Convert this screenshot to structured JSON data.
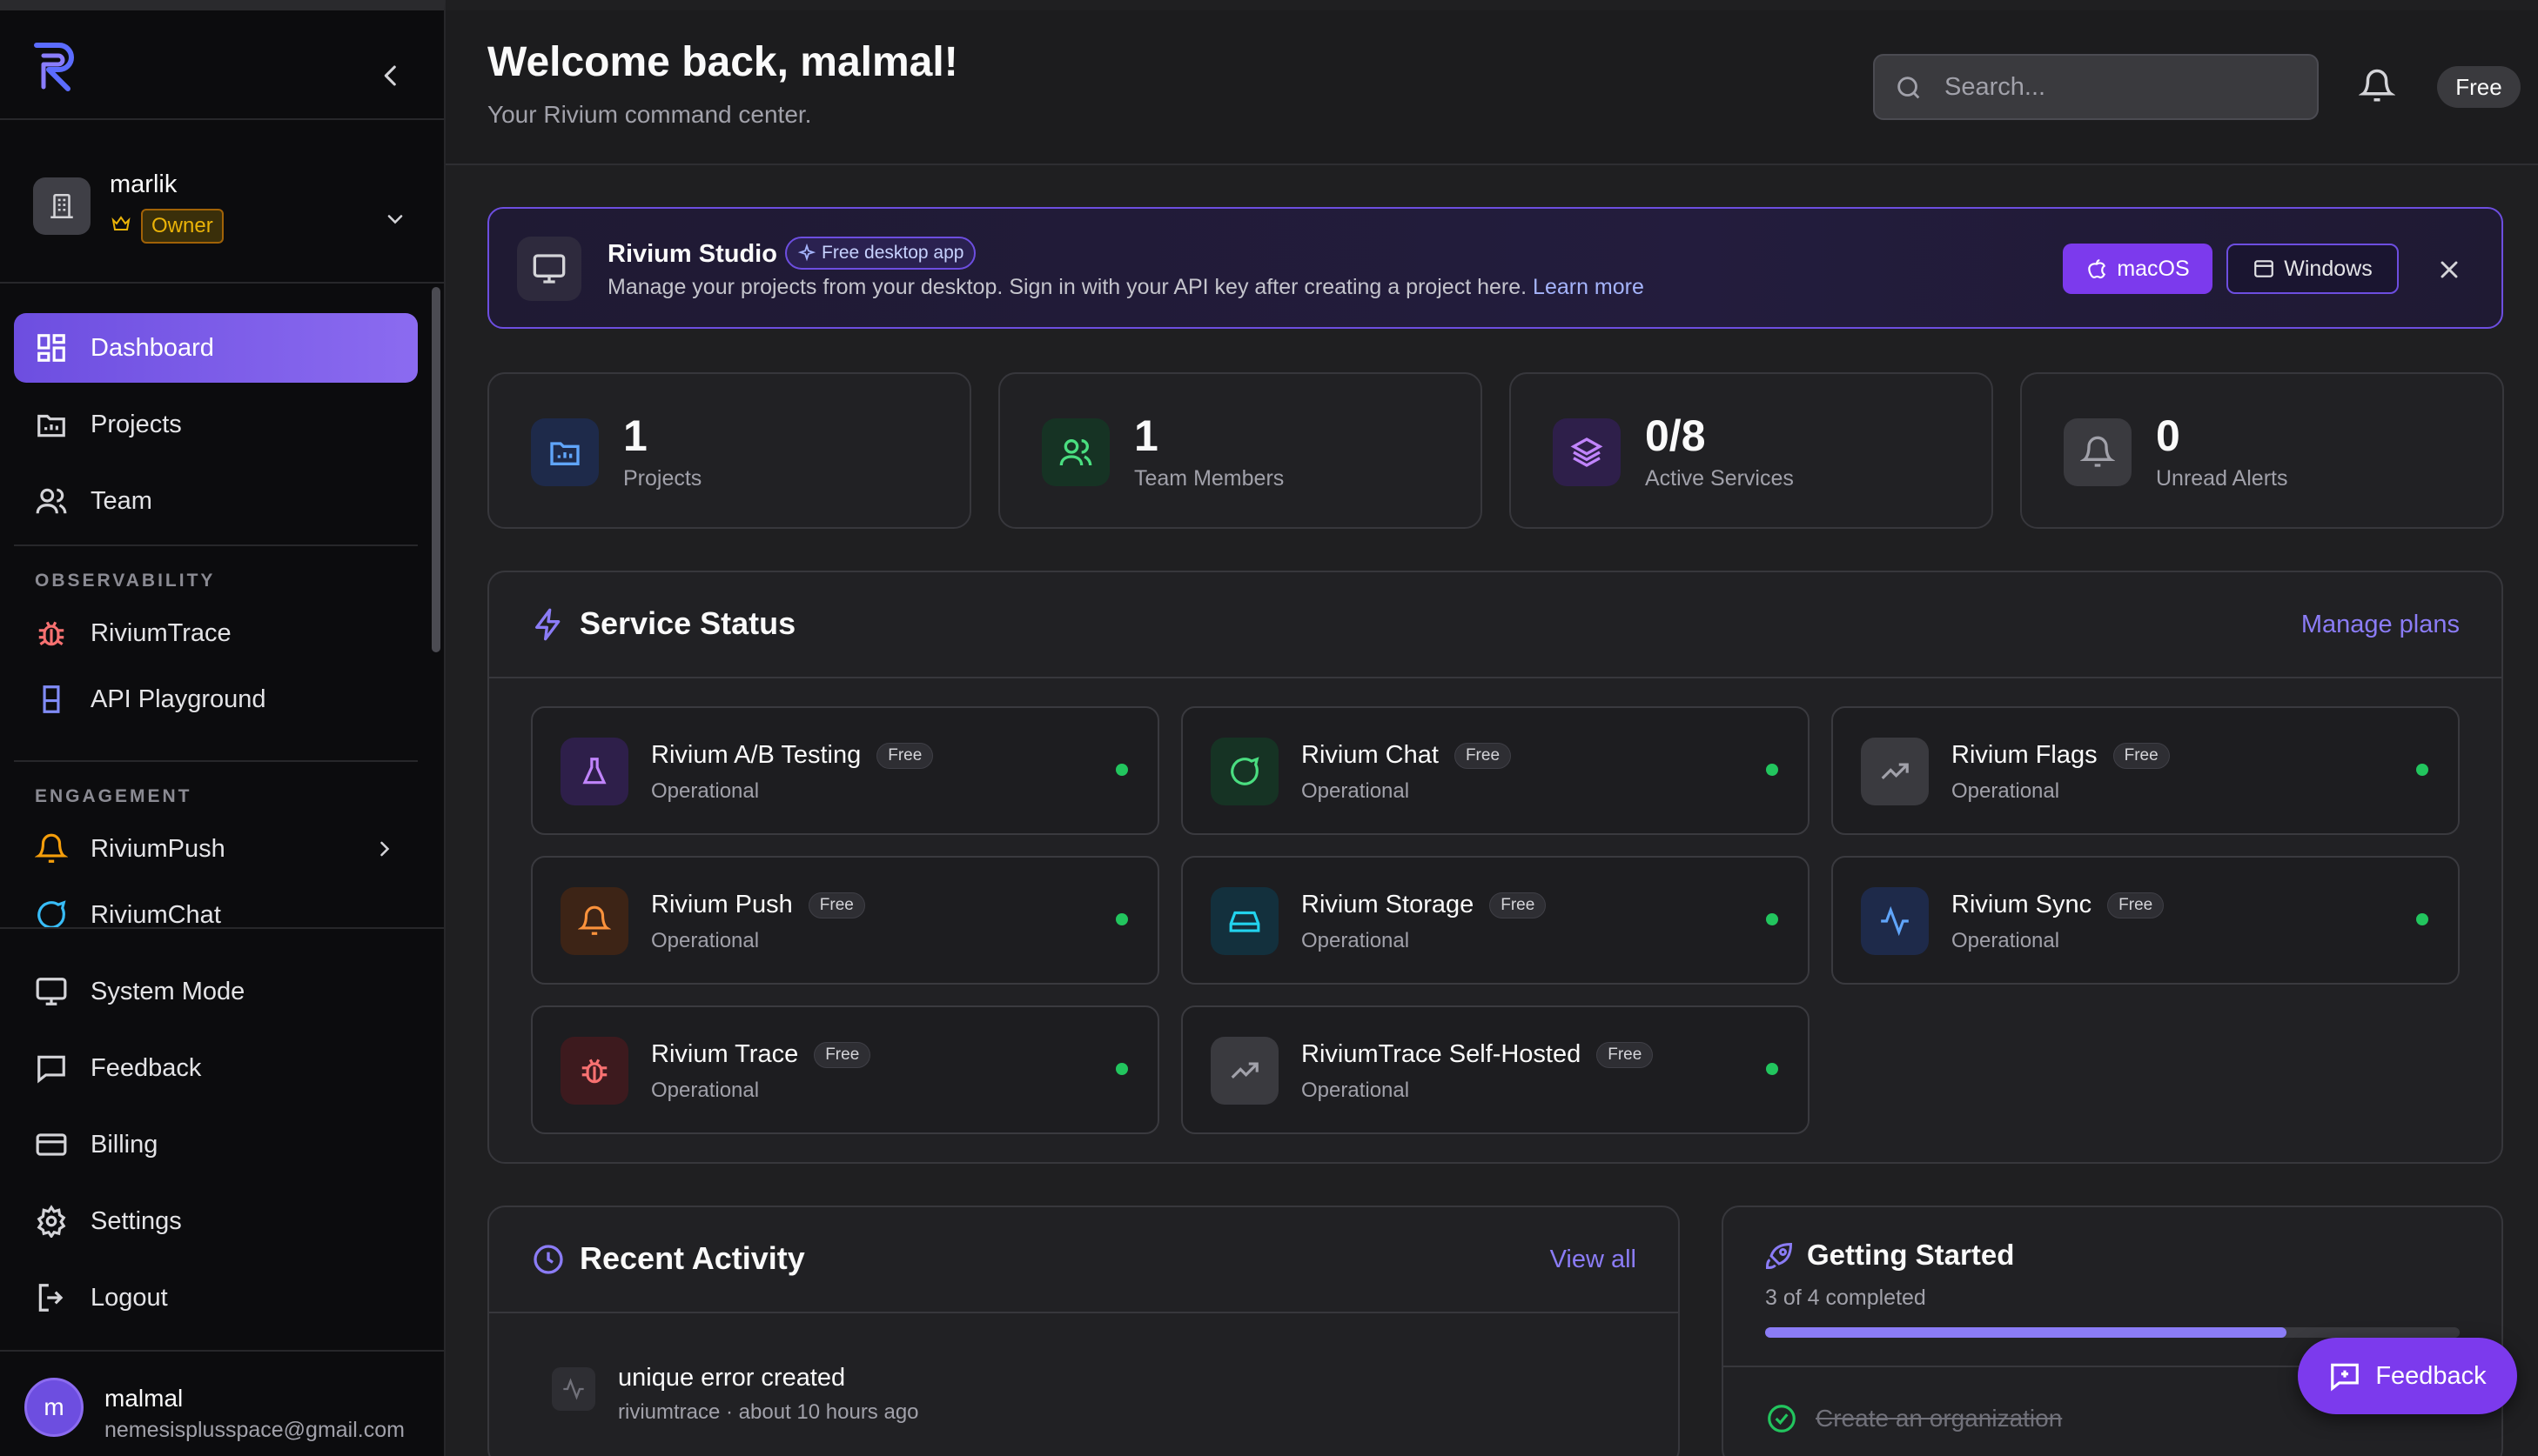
{
  "sidebar": {
    "org": {
      "name": "marlik",
      "role": "Owner"
    },
    "nav_main": [
      {
        "label": "Dashboard",
        "icon": "dashboard-icon"
      },
      {
        "label": "Projects",
        "icon": "projects-icon"
      },
      {
        "label": "Team",
        "icon": "team-icon"
      }
    ],
    "observability_label": "OBSERVABILITY",
    "observability": [
      {
        "label": "RiviumTrace",
        "icon": "bug-icon"
      },
      {
        "label": "API Playground",
        "icon": "flask-icon"
      }
    ],
    "engagement_label": "ENGAGEMENT",
    "engagement": [
      {
        "label": "RiviumPush",
        "icon": "bell-icon"
      },
      {
        "label": "RiviumChat",
        "icon": "chat-icon"
      }
    ],
    "bottom": [
      {
        "label": "System Mode",
        "icon": "monitor-icon"
      },
      {
        "label": "Feedback",
        "icon": "message-icon"
      },
      {
        "label": "Billing",
        "icon": "card-icon"
      },
      {
        "label": "Settings",
        "icon": "gear-icon"
      },
      {
        "label": "Logout",
        "icon": "logout-icon"
      }
    ],
    "user": {
      "initial": "m",
      "name": "malmal",
      "email": "nemesisplusspace@gmail.com"
    }
  },
  "header": {
    "title": "Welcome back, malmal!",
    "subtitle": "Your Rivium command center.",
    "search_placeholder": "Search...",
    "plan": "Free"
  },
  "banner": {
    "title": "Rivium Studio",
    "badge": "Free desktop app",
    "text": "Manage your projects from your desktop. Sign in with your API key after creating a project here.",
    "link": "Learn more",
    "macos": "macOS",
    "windows": "Windows"
  },
  "stats": [
    {
      "value": "1",
      "label": "Projects"
    },
    {
      "value": "1",
      "label": "Team Members"
    },
    {
      "value": "0/8",
      "label": "Active Services"
    },
    {
      "value": "0",
      "label": "Unread Alerts"
    }
  ],
  "service_status": {
    "title": "Service Status",
    "manage": "Manage plans",
    "services": [
      {
        "name": "Rivium A/B Testing",
        "badge": "Free",
        "status": "Operational"
      },
      {
        "name": "Rivium Chat",
        "badge": "Free",
        "status": "Operational"
      },
      {
        "name": "Rivium Flags",
        "badge": "Free",
        "status": "Operational"
      },
      {
        "name": "Rivium Push",
        "badge": "Free",
        "status": "Operational"
      },
      {
        "name": "Rivium Storage",
        "badge": "Free",
        "status": "Operational"
      },
      {
        "name": "Rivium Sync",
        "badge": "Free",
        "status": "Operational"
      },
      {
        "name": "Rivium Trace",
        "badge": "Free",
        "status": "Operational"
      },
      {
        "name": "RiviumTrace Self-Hosted",
        "badge": "Free",
        "status": "Operational"
      }
    ]
  },
  "recent_activity": {
    "title": "Recent Activity",
    "view_all": "View all",
    "items": [
      {
        "title": "unique error created",
        "meta": "riviumtrace · about 10 hours ago"
      }
    ]
  },
  "getting_started": {
    "title": "Getting Started",
    "progress_text": "3 of 4 completed",
    "progress": 0.75,
    "first_task": "Create an organization"
  },
  "feedback_fab": "Feedback",
  "colors": {
    "accent": "#7c4dff",
    "success": "#22c55e",
    "bg": "#1f1f21"
  }
}
